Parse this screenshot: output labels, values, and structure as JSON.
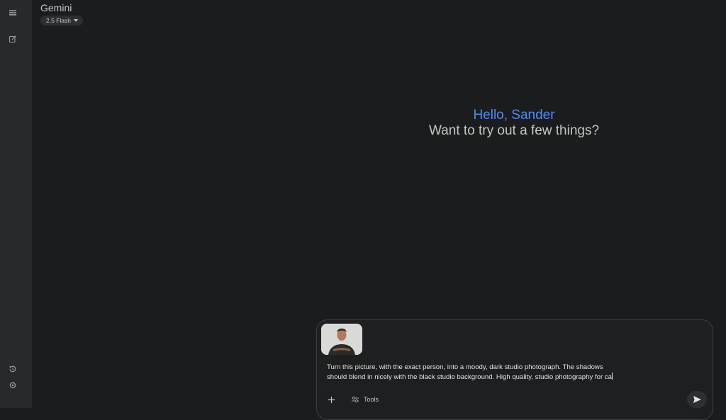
{
  "app": {
    "title": "Gemini",
    "model": "2.5 Flash"
  },
  "rail": {
    "icons": [
      "menu-icon",
      "new-chat-icon",
      "history-icon",
      "settings-icon"
    ]
  },
  "greeting": {
    "hello": "Hello, Sander",
    "subtitle": "Want to try out a few things?"
  },
  "composer": {
    "prompt": "Turn this picture, with the exact person, into a moody, dark studio photograph. The shadows\nshould blend in nicely with the black studio background. High quality, studio photography for ca",
    "tools_label": "Tools",
    "attachment": "person-photo-thumbnail"
  },
  "colors": {
    "background": "#1b1c1d",
    "rail": "#28292a",
    "accent": "#4c8df6"
  }
}
